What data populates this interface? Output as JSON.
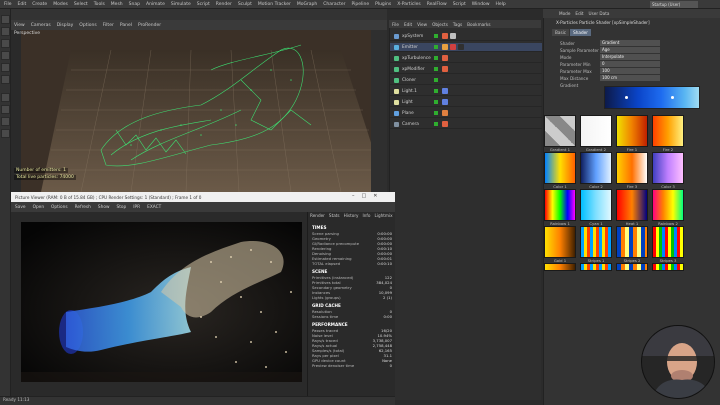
{
  "menubar": {
    "items": [
      "File",
      "Edit",
      "Create",
      "Modes",
      "Select",
      "Tools",
      "Mesh",
      "Snap",
      "Animate",
      "Simulate",
      "Script",
      "Render",
      "Sculpt",
      "Motion Tracker",
      "MoGraph",
      "Character",
      "Pipeline",
      "Plugins",
      "X-Particles",
      "RealFlow",
      "Script",
      "Window",
      "Help"
    ],
    "layout_label": "Layout:",
    "layout_value": "Startup (User)"
  },
  "viewport": {
    "menu": [
      "View",
      "Cameras",
      "Display",
      "Options",
      "Filter",
      "Panel",
      "ProRender"
    ],
    "label": "Perspective",
    "info_line1": "Number of emitters: 1",
    "info_line2": "Total live particles: 74000"
  },
  "object_manager": {
    "menu": [
      "File",
      "Edit",
      "View",
      "Objects",
      "Tags",
      "Bookmarks"
    ],
    "rows": [
      {
        "label": "xpSystem",
        "color": "#6a9ad0",
        "tags": [
          "#e06040",
          "#c0c0c0"
        ]
      },
      {
        "label": "Emitter",
        "color": "#5ab0e0",
        "tags": [
          "#e8a040",
          "#d04040",
          "#303030"
        ]
      },
      {
        "label": "xpTurbulence",
        "color": "#50c080",
        "tags": [
          "#e06040"
        ]
      },
      {
        "label": "xpModifier",
        "color": "#50c080",
        "tags": [
          "#e06040"
        ]
      },
      {
        "label": "Cloner",
        "color": "#50c080",
        "tags": []
      },
      {
        "label": "Light.1",
        "color": "#e0e0a0",
        "tags": [
          "#6080e0"
        ]
      },
      {
        "label": "Light",
        "color": "#e0e0a0",
        "tags": [
          "#6080e0"
        ]
      },
      {
        "label": "Plane",
        "color": "#60a0e0",
        "tags": [
          "#e08040"
        ]
      },
      {
        "label": "Camera",
        "color": "#8090a0",
        "tags": [
          "#e06040"
        ]
      }
    ]
  },
  "attributes": {
    "menu": [
      "Mode",
      "Edit",
      "User Data"
    ],
    "title": "X-Particles Particle Shader [xpSimpleShader]",
    "tabs": [
      "Basic",
      "Shader"
    ],
    "fields": [
      {
        "label": "Shader",
        "value": "Gradient"
      },
      {
        "label": "Sample Parameter",
        "value": "Age"
      },
      {
        "label": "Mode",
        "value": "Interpolate"
      },
      {
        "label": "Parameter Min",
        "value": "0"
      },
      {
        "label": "Parameter Max",
        "value": "100"
      },
      {
        "label": "Max Distance",
        "value": "100 cm"
      },
      {
        "label": "Gradient",
        "value": ""
      }
    ],
    "presets": [
      {
        "label": "Gradient 1",
        "bg": "linear-gradient(45deg,#888 25%,#ccc 25%,#ccc 50%,#888 50%,#888 75%,#ccc 75%)"
      },
      {
        "label": "Gradient 2",
        "bg": "linear-gradient(90deg,#f4f4f4,#ffffff)"
      },
      {
        "label": "Fire 1",
        "bg": "linear-gradient(90deg,#f0e000,#f08000,#c02000)"
      },
      {
        "label": "Fire 2",
        "bg": "linear-gradient(90deg,#ff4000,#ffa000,#fff080)"
      },
      {
        "label": "Color 1",
        "bg": "linear-gradient(90deg,#0080ff,#ffe000,#ff6000)"
      },
      {
        "label": "Color 2",
        "bg": "linear-gradient(90deg,#102060,#60a0ff,#e0f0ff)"
      },
      {
        "label": "Fire 3",
        "bg": "linear-gradient(90deg,#ffd000,#ff7000,#ffffff)"
      },
      {
        "label": "Color 3",
        "bg": "linear-gradient(90deg,#4040c0,#c080ff,#ffc0ff)"
      },
      {
        "label": "Rainbow 1",
        "bg": "linear-gradient(90deg,#ff0000,#ffff00,#00ff00,#0000ff,#ff00ff)"
      },
      {
        "label": "Cyan 1",
        "bg": "linear-gradient(90deg,#00c0ff,#80e0ff,#e0f8ff)"
      },
      {
        "label": "Heat 1",
        "bg": "linear-gradient(90deg,#ff0000,#ff8000,#000080)"
      },
      {
        "label": "Rainbow 2",
        "bg": "linear-gradient(90deg,#ff0080,#ff8000,#ffff00,#00ff80)"
      },
      {
        "label": "Gold 1",
        "bg": "linear-gradient(90deg,#ffe000,#ff8000,#402000)"
      },
      {
        "label": "Stripes 1",
        "bg": "repeating-linear-gradient(90deg,#00a0ff 0 3px,#ffe000 3px 6px,#ff4000 6px 9px)"
      },
      {
        "label": "Stripes 2",
        "bg": "repeating-linear-gradient(90deg,#0040c0 0 4px,#ff8000 4px 8px,#ffff80 8px 12px)"
      },
      {
        "label": "Stripes 3",
        "bg": "repeating-linear-gradient(90deg,#ff0000 0 3px,#ffff00 3px 6px,#00c000 6px 9px,#0080ff 9px 12px)"
      }
    ]
  },
  "render_window": {
    "title": "Picture Viewer (RAM: 0 B of 15.84 GB) ; CPU Render Settings: 1 (Standard) ; Frame 1 of 0",
    "menu": [
      "Save",
      "Open",
      "Options",
      "Refresh",
      "Show",
      "Stop",
      "IPR",
      "EXACT"
    ],
    "stats_tabs": [
      "Render",
      "Stats",
      "History",
      "Info",
      "Lightmix"
    ],
    "sections": [
      {
        "heading": "TIMES",
        "rows": [
          [
            "Scene parsing",
            "0:00:00"
          ],
          [
            "Geometry",
            "0:00:00"
          ],
          [
            "GI/Radiance precompute",
            "0:00:00"
          ],
          [
            "Rendering",
            "0:00:10"
          ],
          [
            "Denoising",
            "0:00:00"
          ],
          [
            "Estimated remaining",
            "0:00:01"
          ],
          [
            "TOTAL elapsed",
            "0:00:10"
          ]
        ]
      },
      {
        "heading": "SCENE",
        "rows": [
          [
            "Primitives (instanced)",
            "122"
          ],
          [
            "Primitives total",
            "384,024"
          ],
          [
            "Secondary geometry",
            "0"
          ],
          [
            "Instances",
            "10,099"
          ],
          [
            "Lights (groups)",
            "2 (1)"
          ]
        ]
      },
      {
        "heading": "GRID CACHE",
        "rows": [
          [
            "Resolution",
            "0"
          ],
          [
            "Sessions time",
            "0:00"
          ]
        ]
      },
      {
        "heading": "PERFORMANCE",
        "rows": [
          [
            "Passes traced",
            "16/20"
          ],
          [
            "Noise level",
            "10.94%"
          ],
          [
            "Rays/s traced",
            "3,738,007"
          ],
          [
            "Rays/s actual",
            "2,758,448"
          ],
          [
            "Samples/s (total)",
            "62,165"
          ],
          [
            "Rays per pixel",
            "31.1"
          ],
          [
            "GPU device count",
            "None"
          ],
          [
            "Preview denoiser time",
            "0"
          ]
        ]
      }
    ],
    "status_text": "Ready 11:13"
  }
}
